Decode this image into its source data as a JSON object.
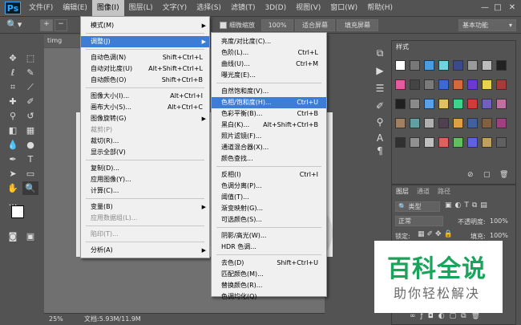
{
  "menubar": {
    "logo": "Ps",
    "items": [
      "文件(F)",
      "编辑(E)",
      "图像(I)",
      "图层(L)",
      "文字(Y)",
      "选择(S)",
      "滤镜(T)",
      "3D(D)",
      "视图(V)",
      "窗口(W)",
      "帮助(H)"
    ],
    "active_index": 2,
    "window_controls": [
      "—",
      "□",
      "✕"
    ]
  },
  "options": {
    "checkbox_label": "细微缩放",
    "zoom_value": "100%",
    "fit_screen": "适合屏幕",
    "fill_screen": "填充屏幕",
    "workspace": "基本功能"
  },
  "document": {
    "tab": "timg (3).jpg",
    "zoom": "25%",
    "status": "文档:5.93M/11.9M"
  },
  "image_menu": {
    "items": [
      {
        "label": "模式(M)",
        "shortcut": "",
        "arrow": true,
        "disabled": false,
        "highlight": false
      },
      {
        "sep": true
      },
      {
        "label": "调整(J)",
        "shortcut": "",
        "arrow": true,
        "disabled": false,
        "highlight": true
      },
      {
        "sep": true
      },
      {
        "label": "自动色调(N)",
        "shortcut": "Shift+Ctrl+L",
        "arrow": false,
        "disabled": false,
        "highlight": false
      },
      {
        "label": "自动对比度(U)",
        "shortcut": "Alt+Shift+Ctrl+L",
        "arrow": false,
        "disabled": false,
        "highlight": false
      },
      {
        "label": "自动颜色(O)",
        "shortcut": "Shift+Ctrl+B",
        "arrow": false,
        "disabled": false,
        "highlight": false
      },
      {
        "sep": true
      },
      {
        "label": "图像大小(I)...",
        "shortcut": "Alt+Ctrl+I",
        "arrow": false,
        "disabled": false,
        "highlight": false
      },
      {
        "label": "画布大小(S)...",
        "shortcut": "Alt+Ctrl+C",
        "arrow": false,
        "disabled": false,
        "highlight": false
      },
      {
        "label": "图像旋转(G)",
        "shortcut": "",
        "arrow": true,
        "disabled": false,
        "highlight": false
      },
      {
        "label": "裁剪(P)",
        "shortcut": "",
        "arrow": false,
        "disabled": true,
        "highlight": false
      },
      {
        "label": "裁切(R)...",
        "shortcut": "",
        "arrow": false,
        "disabled": false,
        "highlight": false
      },
      {
        "label": "显示全部(V)",
        "shortcut": "",
        "arrow": false,
        "disabled": false,
        "highlight": false
      },
      {
        "sep": true
      },
      {
        "label": "复制(D)...",
        "shortcut": "",
        "arrow": false,
        "disabled": false,
        "highlight": false
      },
      {
        "label": "应用图像(Y)...",
        "shortcut": "",
        "arrow": false,
        "disabled": false,
        "highlight": false
      },
      {
        "label": "计算(C)...",
        "shortcut": "",
        "arrow": false,
        "disabled": false,
        "highlight": false
      },
      {
        "sep": true
      },
      {
        "label": "变量(B)",
        "shortcut": "",
        "arrow": true,
        "disabled": false,
        "highlight": false
      },
      {
        "label": "应用数据组(L)...",
        "shortcut": "",
        "arrow": false,
        "disabled": true,
        "highlight": false
      },
      {
        "sep": true
      },
      {
        "label": "陷印(T)...",
        "shortcut": "",
        "arrow": false,
        "disabled": true,
        "highlight": false
      },
      {
        "sep": true
      },
      {
        "label": "分析(A)",
        "shortcut": "",
        "arrow": true,
        "disabled": false,
        "highlight": false
      }
    ]
  },
  "adjust_menu": {
    "items": [
      {
        "label": "亮度/对比度(C)...",
        "shortcut": "",
        "highlight": false
      },
      {
        "label": "色阶(L)...",
        "shortcut": "Ctrl+L",
        "highlight": false
      },
      {
        "label": "曲线(U)...",
        "shortcut": "Ctrl+M",
        "highlight": false
      },
      {
        "label": "曝光度(E)...",
        "shortcut": "",
        "highlight": false
      },
      {
        "sep": true
      },
      {
        "label": "自然饱和度(V)...",
        "shortcut": "",
        "highlight": false
      },
      {
        "label": "色相/饱和度(H)...",
        "shortcut": "Ctrl+U",
        "highlight": true
      },
      {
        "label": "色彩平衡(B)...",
        "shortcut": "Ctrl+B",
        "highlight": false
      },
      {
        "label": "黑白(K)...",
        "shortcut": "Alt+Shift+Ctrl+B",
        "highlight": false
      },
      {
        "label": "照片滤镜(F)...",
        "shortcut": "",
        "highlight": false
      },
      {
        "label": "通道混合器(X)...",
        "shortcut": "",
        "highlight": false
      },
      {
        "label": "颜色查找...",
        "shortcut": "",
        "highlight": false
      },
      {
        "sep": true
      },
      {
        "label": "反相(I)",
        "shortcut": "Ctrl+I",
        "highlight": false
      },
      {
        "label": "色调分离(P)...",
        "shortcut": "",
        "highlight": false
      },
      {
        "label": "阈值(T)...",
        "shortcut": "",
        "highlight": false
      },
      {
        "label": "渐变映射(G)...",
        "shortcut": "",
        "highlight": false
      },
      {
        "label": "可选颜色(S)...",
        "shortcut": "",
        "highlight": false
      },
      {
        "sep": true
      },
      {
        "label": "阴影/高光(W)...",
        "shortcut": "",
        "highlight": false
      },
      {
        "label": "HDR 色调...",
        "shortcut": "",
        "highlight": false
      },
      {
        "sep": true
      },
      {
        "label": "去色(D)",
        "shortcut": "Shift+Ctrl+U",
        "highlight": false
      },
      {
        "label": "匹配颜色(M)...",
        "shortcut": "",
        "highlight": false
      },
      {
        "label": "替换颜色(R)...",
        "shortcut": "",
        "highlight": false
      },
      {
        "label": "色调均化(Q)",
        "shortcut": "",
        "highlight": false
      }
    ]
  },
  "styles_panel": {
    "tab": "样式"
  },
  "layers_panel": {
    "tabs": [
      "图层",
      "通道",
      "路径"
    ],
    "kind": "类型",
    "blend_mode": "正常",
    "opacity_label": "不透明度:",
    "opacity": "100%",
    "lock_label": "锁定:",
    "fill_label": "填充:",
    "fill": "100%"
  },
  "watermark": {
    "title": "百科全说",
    "subtitle": "助你轻松解决"
  },
  "colors": {
    "highlight": "#3e7dd6",
    "watermark_green": "#1aa35a"
  }
}
